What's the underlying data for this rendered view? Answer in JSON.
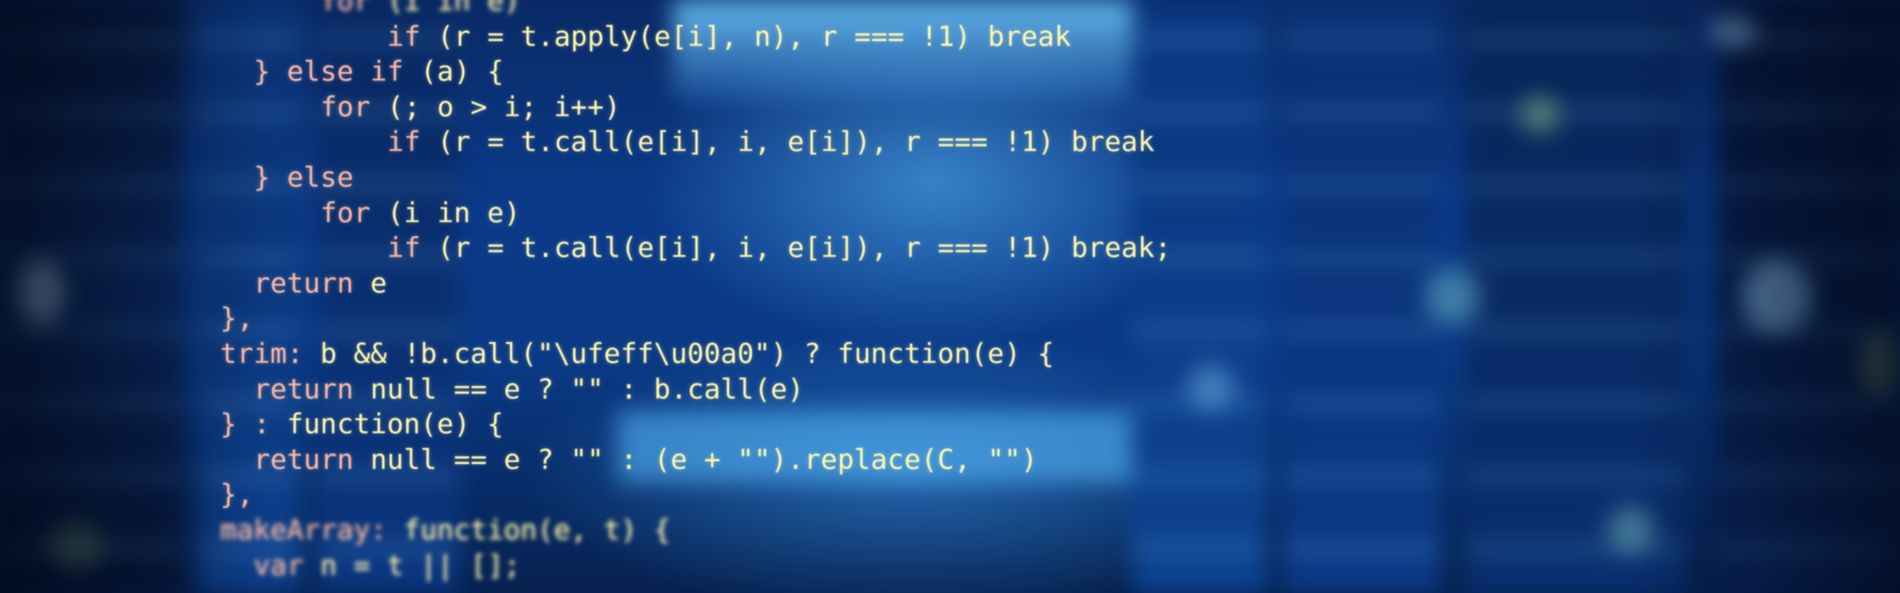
{
  "photo": {
    "subject": "blurred server room corridor with code overlay",
    "colors": {
      "keyword": "#ffb4a6",
      "text": "#fff7b0",
      "background": "#0a3a86"
    }
  },
  "code_lines": [
    {
      "indent": "      ",
      "kw": "for",
      "tx": " (i in e)"
    },
    {
      "indent": "          ",
      "kw": "if",
      "tx": " (r = t.apply(e[i], n), r === !1) break"
    },
    {
      "indent": "  ",
      "kw": "} else if",
      "tx": " (a) {"
    },
    {
      "indent": "      ",
      "kw": "for",
      "tx": " (; o > i; i++)"
    },
    {
      "indent": "          ",
      "kw": "if",
      "tx": " (r = t.call(e[i], i, e[i]), r === !1) break"
    },
    {
      "indent": "  ",
      "kw": "} else",
      "tx": ""
    },
    {
      "indent": "      ",
      "kw": "for",
      "tx": " (i in e)"
    },
    {
      "indent": "          ",
      "kw": "if",
      "tx": " (r = t.call(e[i], i, e[i]), r === !1) break;"
    },
    {
      "indent": "  ",
      "kw": "return",
      "tx": " e"
    },
    {
      "indent": "",
      "kw": "},",
      "tx": ""
    },
    {
      "indent": "",
      "kw": "trim:",
      "tx": " b && !b.call(\"\\ufeff\\u00a0\") ? function(e) {"
    },
    {
      "indent": "  ",
      "kw": "return",
      "tx": " null == e ? \"\" : b.call(e)"
    },
    {
      "indent": "",
      "kw": "} :",
      "tx": " function(e) {"
    },
    {
      "indent": "  ",
      "kw": "return",
      "tx": " null == e ? \"\" : (e + \"\").replace(C, \"\")"
    },
    {
      "indent": "",
      "kw": "},",
      "tx": ""
    },
    {
      "indent": "",
      "kw": "makeArray:",
      "tx": " function(e, t) {"
    },
    {
      "indent": "  ",
      "kw": "var",
      "tx": " n = t || [];"
    }
  ]
}
